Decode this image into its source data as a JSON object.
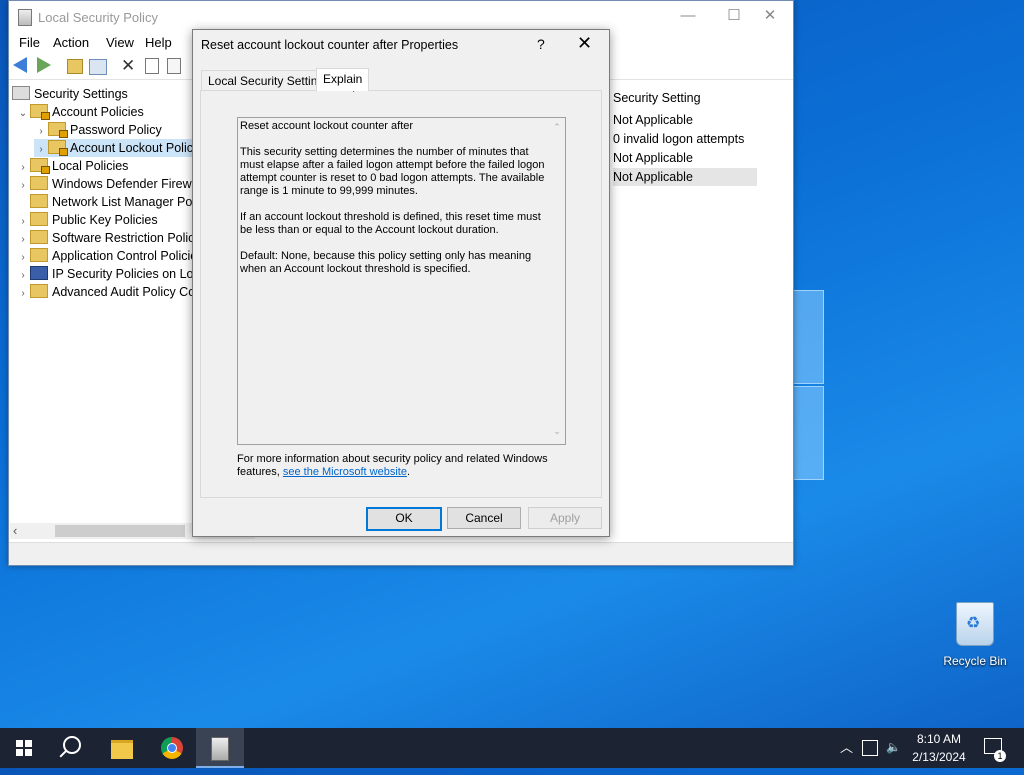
{
  "main_window": {
    "title": "Local Security Policy",
    "controls": {
      "minimize": "—",
      "maximize": "☐",
      "close": "✕"
    },
    "menu": [
      "File",
      "Action",
      "View",
      "Help"
    ],
    "tree": [
      {
        "label": "Security Settings",
        "expander": ""
      },
      {
        "label": "Account Policies",
        "expander": "⌄"
      },
      {
        "label": "Password Policy",
        "expander": "›"
      },
      {
        "label": "Account Lockout Polic",
        "expander": "›"
      },
      {
        "label": "Local Policies",
        "expander": "›"
      },
      {
        "label": "Windows Defender Firewal",
        "expander": "›"
      },
      {
        "label": "Network List Manager Poli",
        "expander": ""
      },
      {
        "label": "Public Key Policies",
        "expander": "›"
      },
      {
        "label": "Software Restriction Policie",
        "expander": "›"
      },
      {
        "label": "Application Control Policie",
        "expander": "›"
      },
      {
        "label": "IP Security Policies on Loca",
        "expander": "›"
      },
      {
        "label": "Advanced Audit Policy Co",
        "expander": "›"
      }
    ],
    "scroll_left_arrow": "‹",
    "right_pane": {
      "header": "Security Setting",
      "rows": [
        "Not Applicable",
        "0 invalid logon attempts",
        "Not Applicable",
        "Not Applicable"
      ]
    }
  },
  "dialog": {
    "title": "Reset account lockout counter after Properties",
    "help": "?",
    "close": "✕",
    "tabs": [
      "Local Security Setting",
      "Explain"
    ],
    "active_tab": "Explain",
    "explain": {
      "heading": "Reset account lockout counter after",
      "p1": "This security setting determines the number of minutes that must elapse after a failed logon attempt before the failed logon attempt counter is reset to 0 bad logon attempts. The available range is 1 minute to 99,999 minutes.",
      "p2": "If an account lockout threshold is defined, this reset time must be less than or equal to the Account lockout duration.",
      "p3": "Default: None, because this policy setting only has meaning when an Account lockout threshold is specified.",
      "scroll_up": "⌃",
      "scroll_down": "⌄"
    },
    "more_info_text": "For more information about security policy and related Windows features, ",
    "more_info_link": "see the Microsoft website",
    "more_info_end": ".",
    "buttons": {
      "ok": "OK",
      "cancel": "Cancel",
      "apply": "Apply"
    }
  },
  "desktop": {
    "recycle_bin_label": "Recycle Bin"
  },
  "taskbar": {
    "time": "8:10 AM",
    "date": "2/13/2024",
    "tray_chevron": "︿",
    "notification_count": "1"
  },
  "colors": {
    "selection": "#cce4f7",
    "link": "#0066cc",
    "default_button_border": "#0078d7",
    "taskbar": "#1c2433"
  }
}
